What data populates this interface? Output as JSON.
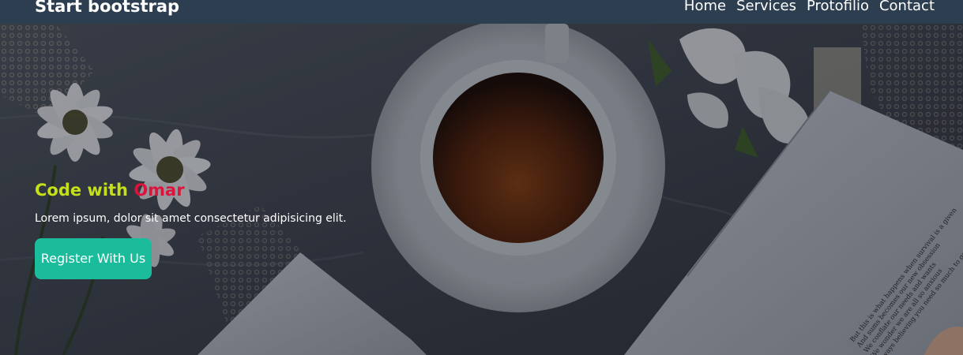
{
  "navbar": {
    "brand": "Start bootstrap",
    "links": [
      {
        "label": "Home"
      },
      {
        "label": "Services"
      },
      {
        "label": "Protofilio"
      },
      {
        "label": "Contact"
      }
    ]
  },
  "hero": {
    "title_prefix": "Code with ",
    "title_accent": "Omar",
    "subtitle": "Lorem ipsum, dolor sit amet consectetur adipisicing elit.",
    "button_label": "Register With Us"
  },
  "book_text": [
    "But this is what happens when survival is a given",
    "And sums becomes our new obsession",
    "We conflate our needs and wants",
    "We wonder we are all so anxious",
    "Always believing you need so much to get by"
  ],
  "colors": {
    "navbar_bg": "#2c3e50",
    "title": "#c5e018",
    "title_accent": "#dc143c",
    "button_bg": "#1abc9c"
  }
}
